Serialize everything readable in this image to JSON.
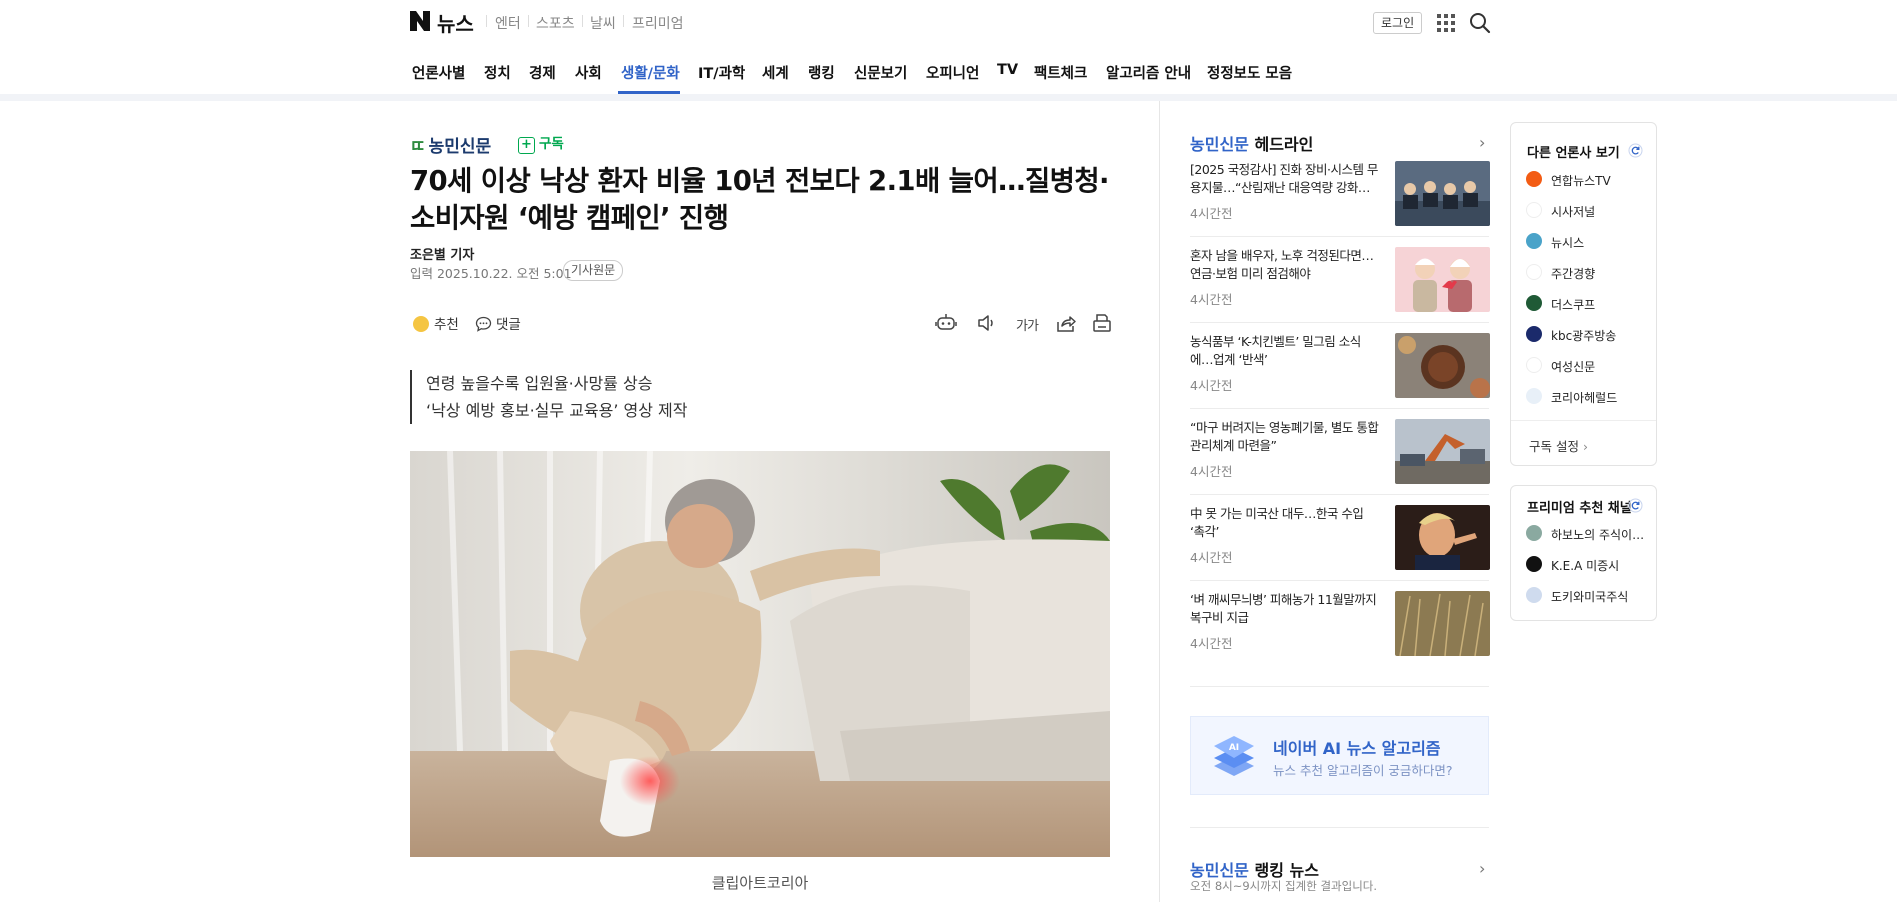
{
  "header": {
    "logo": "N",
    "brand": "뉴스",
    "sections": [
      "엔터",
      "스포츠",
      "날씨",
      "프리미엄"
    ],
    "login_label": "로그인"
  },
  "nav": {
    "items": [
      "언론사별",
      "정치",
      "경제",
      "사회",
      "생활/문화",
      "IT/과학",
      "세계",
      "랭킹",
      "신문보기",
      "오피니언",
      "TV",
      "팩트체크",
      "알고리즘 안내",
      "정정보도 모음"
    ],
    "active": "생활/문화"
  },
  "article": {
    "press": "농민신문",
    "subscribe_label": "구독",
    "headline": "70세 이상 낙상 환자 비율 10년 전보다 2.1배 늘어…질병청·소비자원 ‘예방 캠페인’ 진행",
    "reporter": "조은별 기자",
    "datetime": "입력 2025.10.22. 오전 5:01",
    "original_label": "기사원문",
    "recommend_label": "추천",
    "comment_label": "댓글",
    "subheads": [
      "연령 높을수록 입원율·사망률 상승",
      "‘낙상 예방 홍보·실무 교육용’ 영상 제작"
    ],
    "photo_caption": "클립아트코리아",
    "text_size_label": "가가"
  },
  "headlines": {
    "press": "농민신문",
    "title": "헤드라인",
    "items": [
      {
        "title": "[2025 국정감사] 진화 장비·시스템 무용지물…“산림재난 대응역량 강화…",
        "time": "4시간전"
      },
      {
        "title": "혼자 남을 배우자, 노후 걱정된다면…연금·보험 미리 점검해야",
        "time": "4시간전"
      },
      {
        "title": "농식품부 ‘K-치킨벨트’ 밀그림 소식에…업계 ‘반색’",
        "time": "4시간전"
      },
      {
        "title": "“마구 버려지는 영농폐기물, 별도 통합 관리체계 마련을”",
        "time": "4시간전"
      },
      {
        "title": "中 못 가는 미국산 대두…한국 수입 ‘촉각’",
        "time": "4시간전"
      },
      {
        "title": "‘벼 깨씨무늬병’ 피해농가 11월말까지 복구비 지급",
        "time": "4시간전"
      }
    ]
  },
  "ai_banner": {
    "title": "네이버 AI 뉴스 알고리즘",
    "subtitle": "뉴스 추천 알고리즘이 궁금하다면?"
  },
  "ranking": {
    "press": "농민신문",
    "title": "랭킹 뉴스",
    "subtitle": "오전 8시~9시까지 집계한 결과입니다."
  },
  "other_press": {
    "title": "다른 언론사 보기",
    "items": [
      "연합뉴스TV",
      "시사저널",
      "뉴시스",
      "주간경향",
      "더스쿠프",
      "kbc광주방송",
      "여성신문",
      "코리아헤럴드"
    ],
    "setting_label": "구독 설정"
  },
  "premium": {
    "title": "프리미엄 추천 채널",
    "items": [
      "하보노의 주식이…",
      "K.E.A 미증시",
      "도키와미국주식"
    ]
  }
}
